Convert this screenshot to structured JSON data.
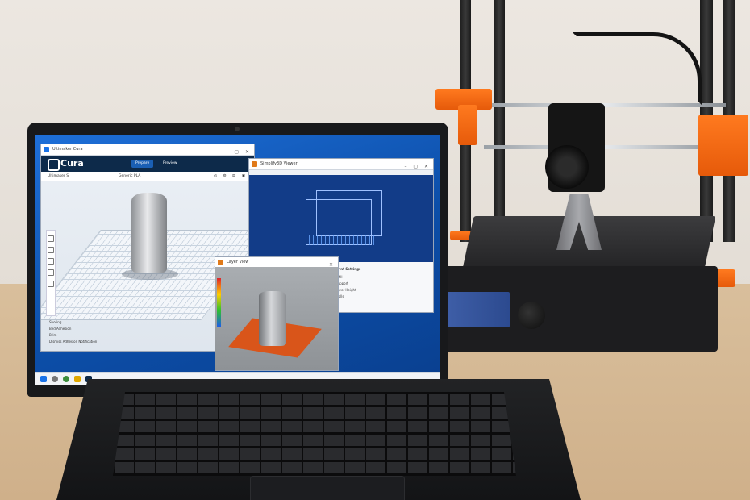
{
  "scene": {
    "description_free": true
  },
  "laptop": {
    "windows": {
      "cura": {
        "title": "Ultimaker Cura",
        "logo_text": "Cura",
        "tabs": [
          "Prepare",
          "Preview"
        ],
        "toolbar_left": "Ultimaker S",
        "toolbar_mid": "Generic PLA",
        "sidebar_notes": [
          "Shoring",
          "Bed Adhesion",
          "Brim",
          "Dismiss Adhesion Notification"
        ]
      },
      "blue_viewer": {
        "title": "Simplify3D Viewer"
      },
      "preview": {
        "title": "Layer View",
        "panel_title": "Print Settings",
        "panel_rows": [
          "Infill",
          "Support",
          "Layer Height",
          "Walls"
        ]
      }
    },
    "taskbar_icons": [
      "start-icon",
      "search-icon",
      "browser-icon",
      "folder-icon",
      "cura-icon"
    ]
  },
  "colors": {
    "printer_accent": "#ff7a1f",
    "desktop_blue": "#1e6fd8",
    "cura_header": "#0d2a4a"
  }
}
